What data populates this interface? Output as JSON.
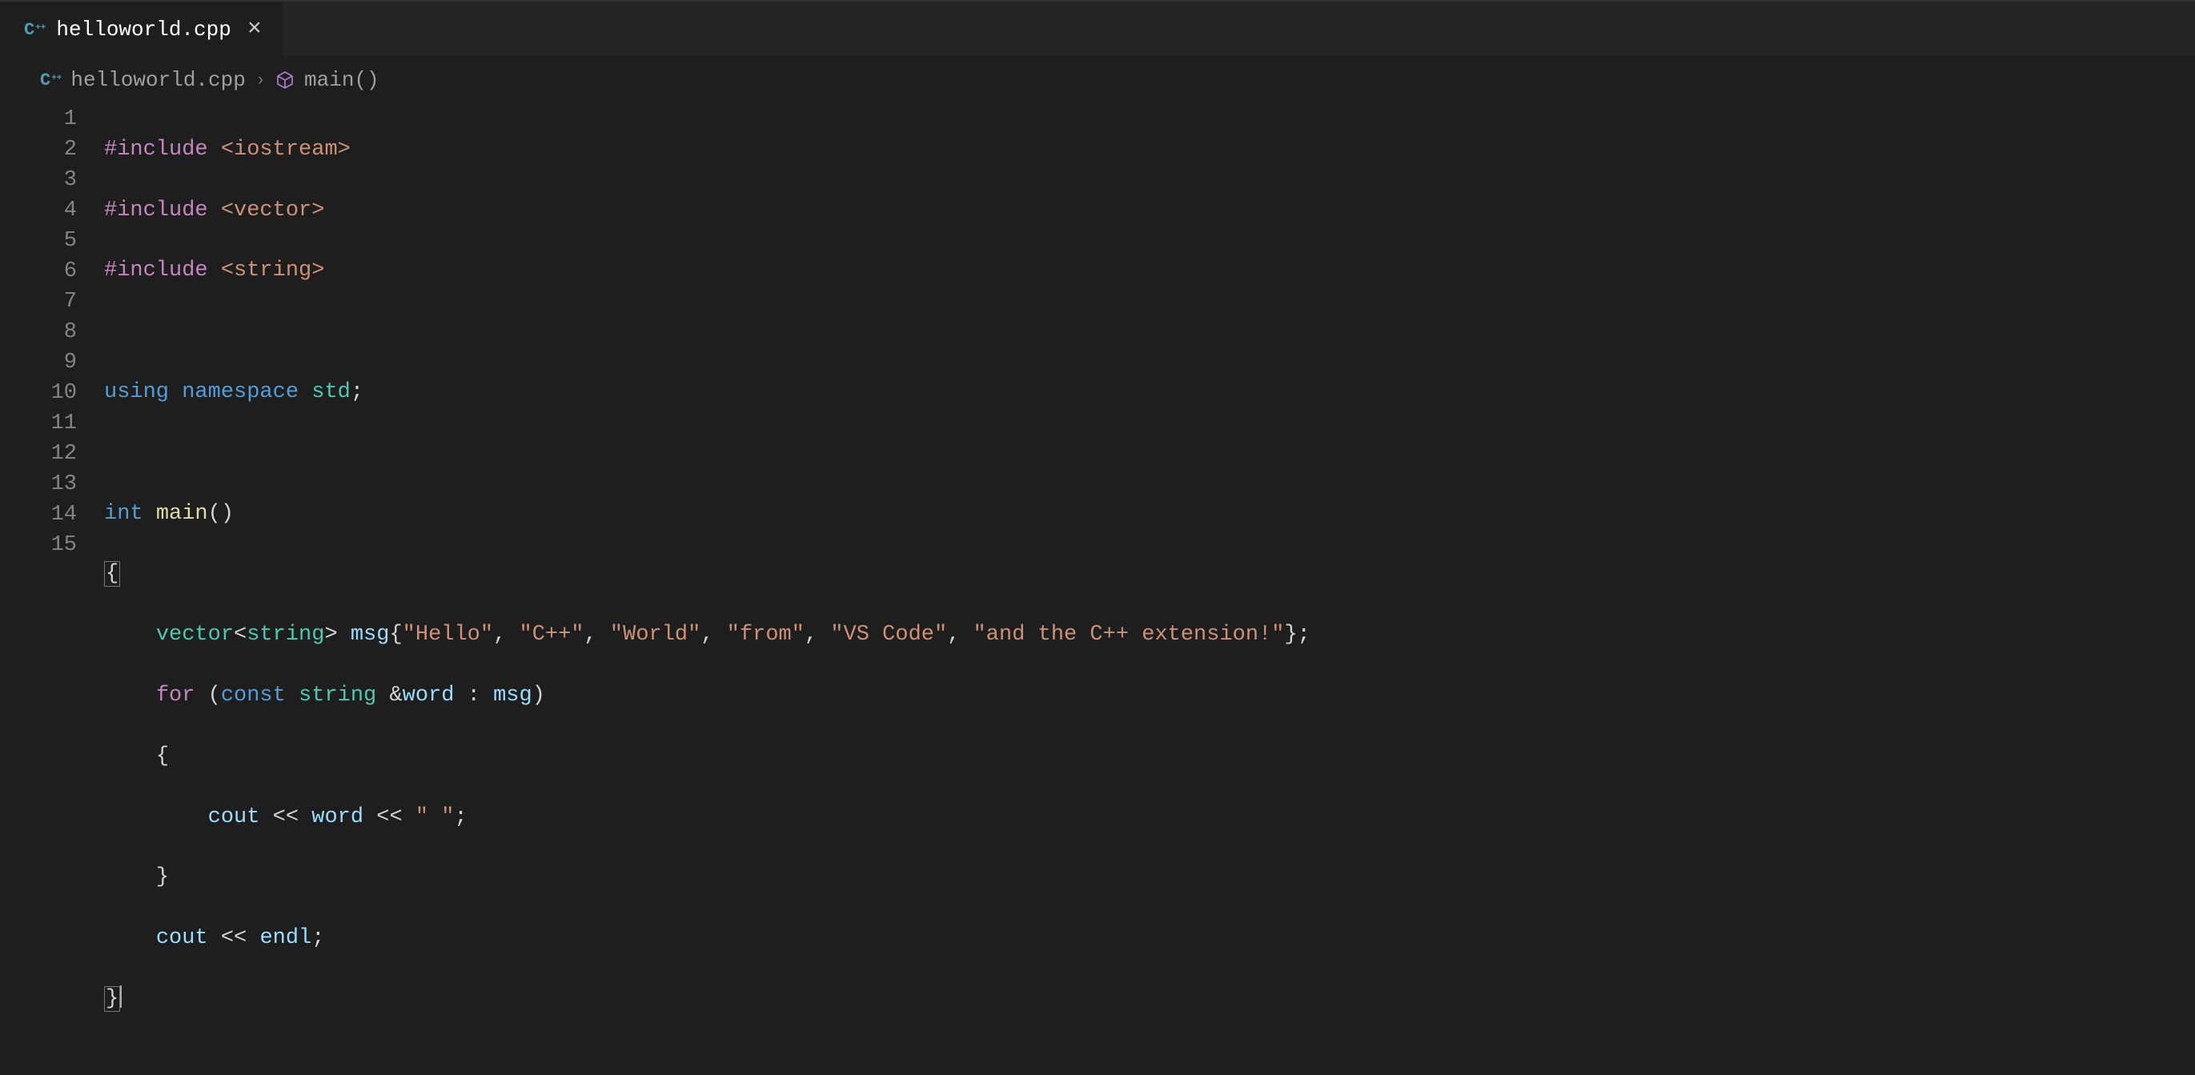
{
  "tab": {
    "filename": "helloworld.cpp"
  },
  "breadcrumb": {
    "file": "helloworld.cpp",
    "symbol": "main()"
  },
  "breakpoint_line": 12,
  "line_numbers": [
    "1",
    "2",
    "3",
    "4",
    "5",
    "6",
    "7",
    "8",
    "9",
    "10",
    "11",
    "12",
    "13",
    "14",
    "15"
  ],
  "code": {
    "l1": {
      "a": "#include",
      "b": " ",
      "c": "<iostream>"
    },
    "l2": {
      "a": "#include",
      "b": " ",
      "c": "<vector>"
    },
    "l3": {
      "a": "#include",
      "b": " ",
      "c": "<string>"
    },
    "l4": "",
    "l5": {
      "a": "using",
      "b": " ",
      "c": "namespace",
      "d": " ",
      "e": "std",
      "f": ";"
    },
    "l6": "",
    "l7": {
      "a": "int",
      "b": " ",
      "c": "main",
      "d": "()"
    },
    "l8": {
      "a": "{"
    },
    "l9": {
      "a": "    ",
      "b": "vector",
      "c": "<",
      "d": "string",
      "e": "> ",
      "f": "msg",
      "g": "{",
      "h": "\"Hello\"",
      "i": ", ",
      "j": "\"C++\"",
      "k": ", ",
      "l": "\"World\"",
      "m": ", ",
      "n": "\"from\"",
      "o": ", ",
      "p": "\"VS Code\"",
      "q": ", ",
      "r": "\"and the C++ extension!\"",
      "s": "};"
    },
    "l10": {
      "a": "    ",
      "b": "for",
      "c": " (",
      "d": "const",
      "e": " ",
      "f": "string",
      "g": " &",
      "h": "word",
      "i": " : ",
      "j": "msg",
      "k": ")"
    },
    "l11": {
      "a": "    ",
      "b": "{"
    },
    "l12": {
      "a": "        ",
      "b": "cout",
      "c": " << ",
      "d": "word",
      "e": " << ",
      "f": "\" \"",
      "g": ";"
    },
    "l13": {
      "a": "    ",
      "b": "}"
    },
    "l14": {
      "a": "    ",
      "b": "cout",
      "c": " << ",
      "d": "endl",
      "e": ";"
    },
    "l15": {
      "a": "}"
    }
  }
}
